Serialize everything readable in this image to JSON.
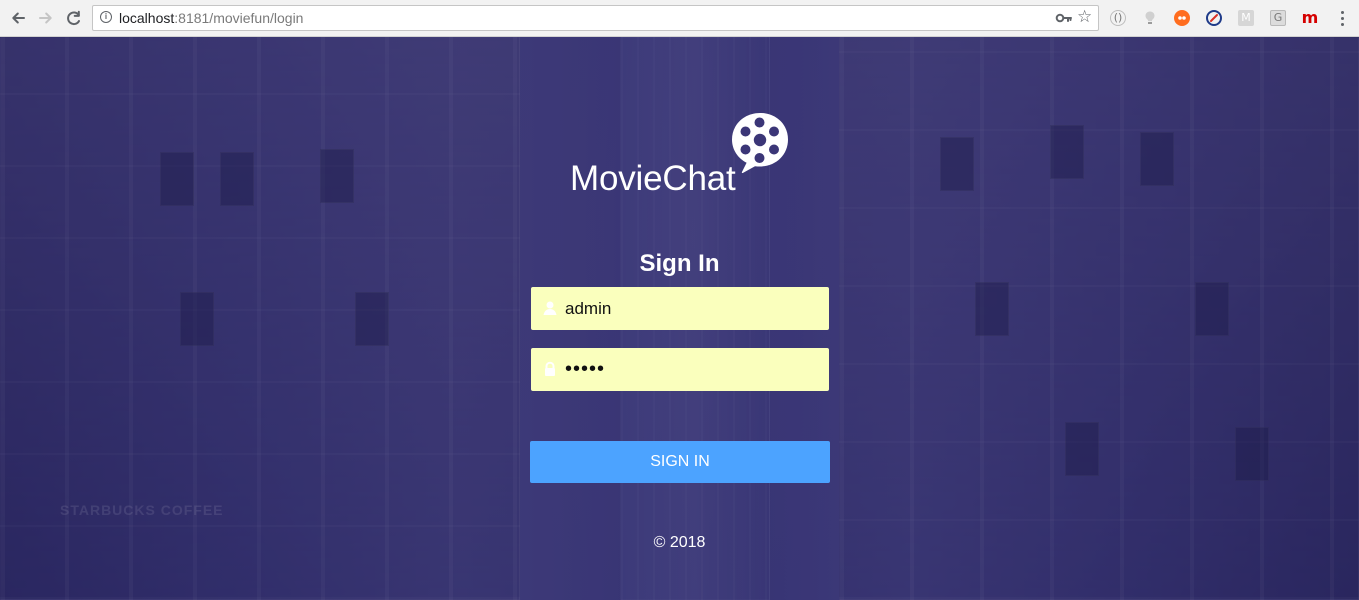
{
  "browser": {
    "url_host": "localhost",
    "url_rest": ":8181/moviefun/login",
    "back_icon": "arrow-left-icon",
    "forward_icon": "arrow-right-icon",
    "reload_icon": "reload-icon",
    "site_info_icon": "info-icon",
    "password_icon": "key-icon",
    "bookmark_icon": "star-icon",
    "extensions": [
      {
        "name": "circle-extension-icon",
        "label": "()"
      },
      {
        "name": "bulb-extension-icon",
        "label": ""
      },
      {
        "name": "tampermonkey-extension-icon",
        "label": ""
      },
      {
        "name": "block-extension-icon",
        "label": ""
      },
      {
        "name": "m-extension-icon",
        "label": "M"
      },
      {
        "name": "g-extension-icon",
        "label": "G"
      },
      {
        "name": "m-red-extension-icon",
        "label": "m"
      }
    ],
    "menu_icon": "more-vert-icon"
  },
  "app": {
    "name": "MovieChat",
    "logo_icon": "film-reel-chat-icon"
  },
  "login": {
    "title": "Sign In",
    "username": {
      "value": "admin",
      "icon": "user-icon"
    },
    "password": {
      "value": "•••••",
      "icon": "lock-icon"
    },
    "submit_label": "SIGN IN"
  },
  "footer": {
    "copyright": "© 2018"
  },
  "colors": {
    "page_overlay": "#292465",
    "input_background": "#faffbd",
    "button": "#4ca3ff",
    "text": "#ffffff"
  }
}
